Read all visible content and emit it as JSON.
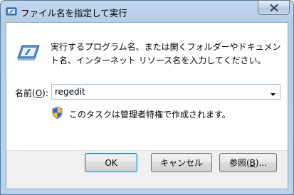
{
  "window": {
    "title": "ファイル名を指定して実行",
    "close_label": "✕"
  },
  "dialog": {
    "description": "実行するプログラム名、または開くフォルダーやドキュメント名、インターネット リソース名を入力してください。",
    "name_label_prefix": "名前(",
    "name_label_accesskey": "O",
    "name_label_suffix": "):",
    "name_value": "regedit",
    "admin_note": "このタスクは管理者特権で作成されます。"
  },
  "buttons": {
    "ok": "OK",
    "cancel": "キャンセル",
    "browse_prefix": "参照(",
    "browse_accesskey": "B",
    "browse_suffix": ")..."
  },
  "icons": {
    "title": "run-icon",
    "dialog": "run-icon",
    "admin": "uac-shield-icon",
    "dropdown": "chevron-down-icon",
    "close": "close-icon"
  }
}
